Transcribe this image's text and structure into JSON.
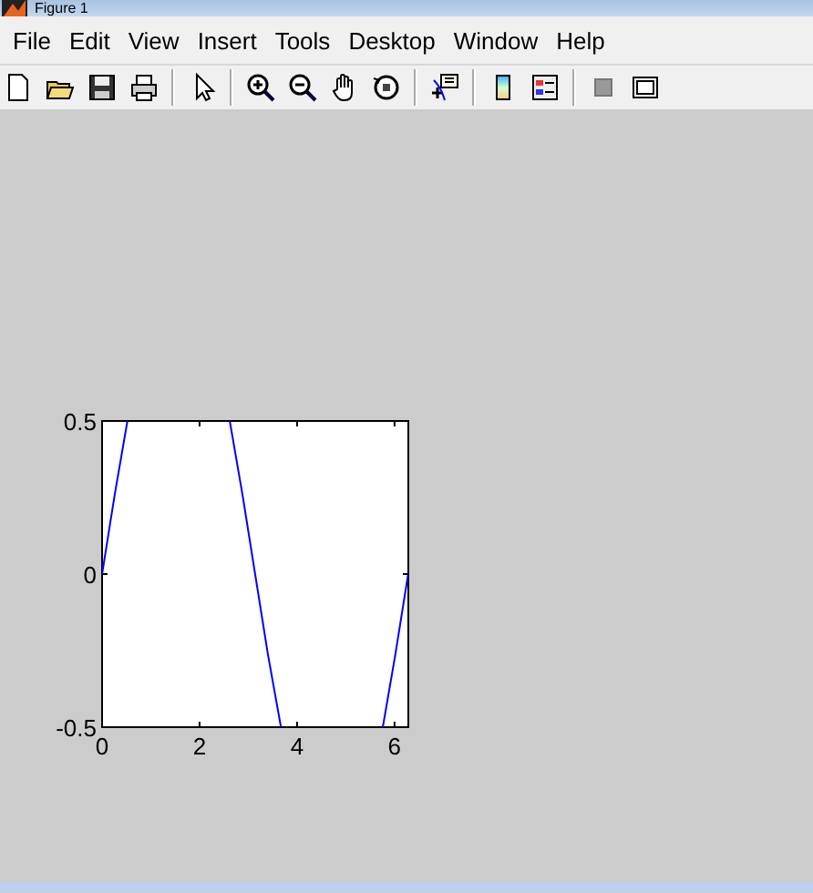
{
  "window": {
    "title": "Figure 1"
  },
  "menu": [
    "File",
    "Edit",
    "View",
    "Insert",
    "Tools",
    "Desktop",
    "Window",
    "Help"
  ],
  "axes": {
    "chart_data": {
      "type": "line",
      "xlim": [
        0,
        6.2832
      ],
      "ylim": [
        -0.5,
        0.5
      ],
      "xticks": [
        0,
        2,
        4,
        6
      ],
      "yticks": [
        -0.5,
        0,
        0.5
      ],
      "x": [
        0,
        0.26,
        0.52,
        2.62,
        2.88,
        3.14,
        3.4,
        3.67,
        5.76,
        6.02,
        6.28
      ],
      "series": [
        {
          "color": "#0000ff",
          "values": [
            0,
            0.26,
            0.5,
            0.5,
            0.26,
            0,
            -0.26,
            -0.5,
            -0.5,
            -0.26,
            0
          ]
        }
      ]
    }
  }
}
